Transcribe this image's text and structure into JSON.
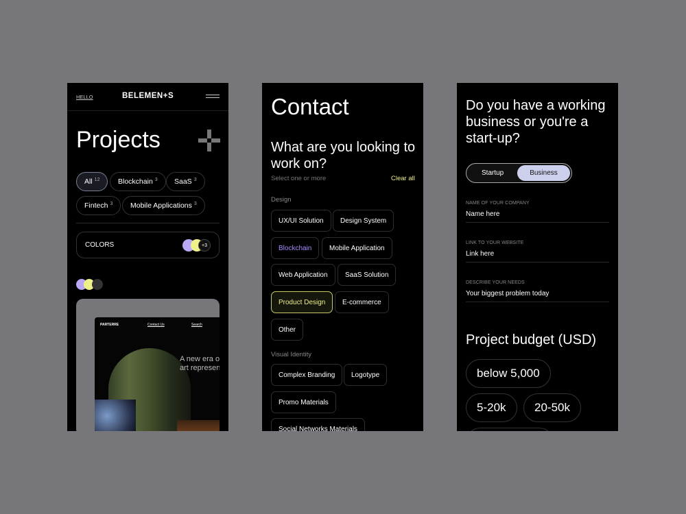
{
  "projects_screen": {
    "hello_link": "HELLO",
    "logo": "BELEMEN+S",
    "menu_icon": "hamburger-icon",
    "title": "Projects",
    "plus_icon": "plus-icon",
    "filters": [
      {
        "label": "All",
        "count": "12"
      },
      {
        "label": "Blockchain",
        "count": "3"
      },
      {
        "label": "SaaS",
        "count": "3"
      },
      {
        "label": "Fintech",
        "count": "3"
      },
      {
        "label": "Mobile Applications",
        "count": "3"
      }
    ],
    "colors_label": "COLORS",
    "colors_more": "+3",
    "swatches": [
      "#b9a8f5",
      "#eef08a",
      "#333333"
    ],
    "preview": {
      "brand": "PARTERRE",
      "nav1": "Contact Us",
      "nav2": "Search",
      "headline1": "A new era o",
      "headline2": "art represen"
    }
  },
  "contact_screen": {
    "title": "Contact",
    "question": "What are you looking to work on?",
    "hint": "Select one or more",
    "clear": "Clear all",
    "sections": [
      {
        "label": "Design",
        "chips": [
          "UX/UI Solution",
          "Design System",
          "Blockchain",
          "Mobile Application",
          "Web Application",
          "SaaS Solution",
          "Product Design",
          "E-commerce",
          "Other"
        ]
      },
      {
        "label": "Visual Identity",
        "chips": [
          "Complex Branding",
          "Logotype",
          "Promo Materials",
          "Social Networks Materials"
        ]
      }
    ],
    "accent_yellow": "#eef08a",
    "accent_purple": "#a78bfa"
  },
  "business_screen": {
    "question": "Do you have a working business or you're a start-up?",
    "toggle": {
      "startup": "Startup",
      "business": "Business",
      "selected": "Business"
    },
    "fields": [
      {
        "label": "NAME OF YOUR COMPANY",
        "value": "Name here"
      },
      {
        "label": "LINK TO YOUR WEBSITE",
        "value": "Link here"
      },
      {
        "label": "DESCRIBE YOUR NEEDS",
        "value": "Your biggest problem today"
      }
    ],
    "budget_title": "Project budget (USD)",
    "budgets": [
      "below 5,000",
      "5-20k",
      "20-50k"
    ]
  }
}
